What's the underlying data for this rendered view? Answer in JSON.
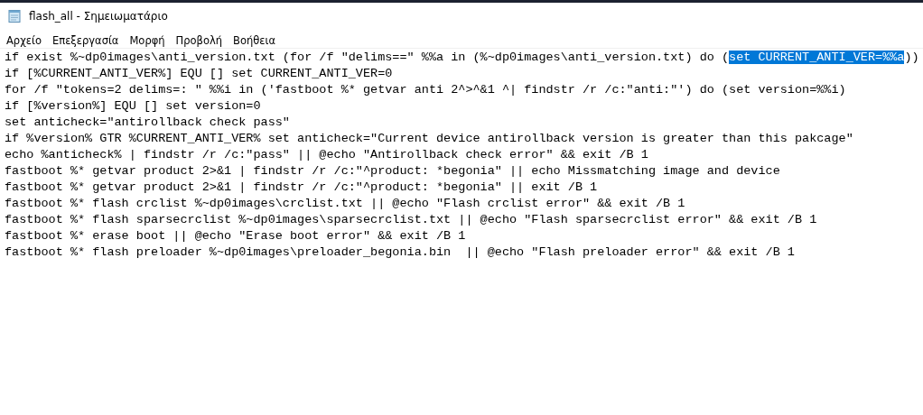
{
  "window": {
    "title": "flash_all - Σημειωματάριο"
  },
  "menu": [
    "Αρχείο",
    "Επεξεργασία",
    "Μορφή",
    "Προβολή",
    "Βοήθεια"
  ],
  "editor": {
    "lines": [
      {
        "segments": [
          {
            "text": "if exist %~dp0images\\anti_version.txt (for /f \"delims==\" %%a in (%~dp0images\\anti_version.txt) do (",
            "selected": false
          },
          {
            "text": "set CURRENT_ANTI_VER=%%a",
            "selected": true
          },
          {
            "text": "))",
            "selected": false
          }
        ]
      },
      {
        "segments": [
          {
            "text": "if [%CURRENT_ANTI_VER%] EQU [] set CURRENT_ANTI_VER=0",
            "selected": false
          }
        ]
      },
      {
        "segments": [
          {
            "text": "for /f \"tokens=2 delims=: \" %%i in ('fastboot %* getvar anti 2^>^&1 ^| findstr /r /c:\"anti:\"') do (set version=%%i)",
            "selected": false
          }
        ]
      },
      {
        "segments": [
          {
            "text": "if [%version%] EQU [] set version=0",
            "selected": false
          }
        ]
      },
      {
        "segments": [
          {
            "text": "set anticheck=\"antirollback check pass\"",
            "selected": false
          }
        ]
      },
      {
        "segments": [
          {
            "text": "if %version% GTR %CURRENT_ANTI_VER% set anticheck=\"Current device antirollback version is greater than this pakcage\"",
            "selected": false
          }
        ]
      },
      {
        "segments": [
          {
            "text": "echo %anticheck% | findstr /r /c:\"pass\" || @echo \"Antirollback check error\" && exit /B 1",
            "selected": false
          }
        ]
      },
      {
        "segments": [
          {
            "text": "fastboot %* getvar product 2>&1 | findstr /r /c:\"^product: *begonia\" || echo Missmatching image and device",
            "selected": false
          }
        ]
      },
      {
        "segments": [
          {
            "text": "fastboot %* getvar product 2>&1 | findstr /r /c:\"^product: *begonia\" || exit /B 1",
            "selected": false
          }
        ]
      },
      {
        "segments": [
          {
            "text": "fastboot %* flash crclist %~dp0images\\crclist.txt || @echo \"Flash crclist error\" && exit /B 1",
            "selected": false
          }
        ]
      },
      {
        "segments": [
          {
            "text": "fastboot %* flash sparsecrclist %~dp0images\\sparsecrclist.txt || @echo \"Flash sparsecrclist error\" && exit /B 1",
            "selected": false
          }
        ]
      },
      {
        "segments": [
          {
            "text": "fastboot %* erase boot || @echo \"Erase boot error\" && exit /B 1",
            "selected": false
          }
        ]
      },
      {
        "segments": [
          {
            "text": "fastboot %* flash preloader %~dp0images\\preloader_begonia.bin  || @echo \"Flash preloader error\" && exit /B 1",
            "selected": false
          }
        ]
      }
    ]
  }
}
